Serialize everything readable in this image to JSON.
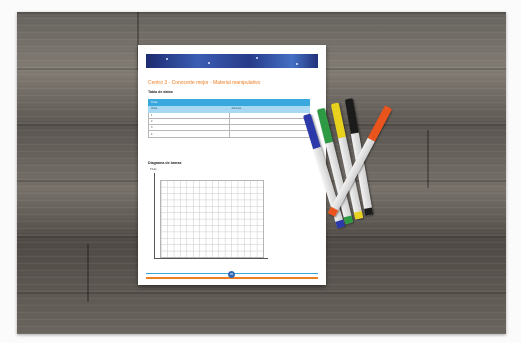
{
  "worksheet": {
    "title": "Centro 3 - Conocerte mejor - Material manipulativo",
    "section_table": "Tabla de datos",
    "table_header": "Título",
    "table_columns": [
      "Votos",
      "Alumnos"
    ],
    "table_rows": [
      "1",
      "2",
      "3",
      "4"
    ],
    "section_chart": "Diagrama de barras",
    "chart_axis_label": "Título",
    "page_number": "25"
  },
  "colors": {
    "title_accent": "#ef7d22",
    "table_header": "#38a8de",
    "banner": "#2a4391",
    "markers": [
      "#2b3aa8",
      "#2e9a43",
      "#e8d21d",
      "#1b1b1b",
      "#e8541c"
    ]
  }
}
